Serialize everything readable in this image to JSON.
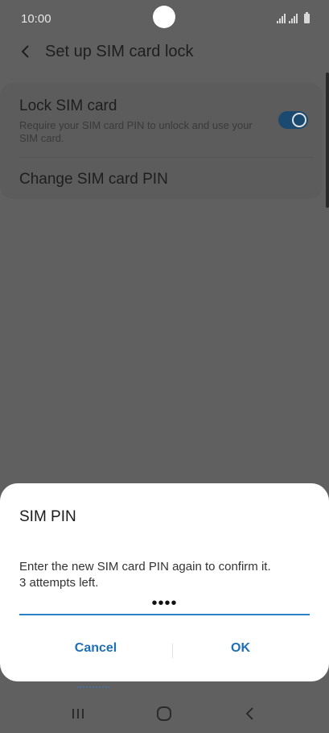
{
  "status_bar": {
    "time": "10:00",
    "icons": [
      "signal-icon",
      "signal-icon",
      "battery-icon"
    ]
  },
  "app_bar": {
    "back_icon": "chevron-left-icon",
    "title": "Set up SIM card lock"
  },
  "settings": {
    "lock_sim": {
      "title": "Lock SIM card",
      "description": "Require your SIM card PIN to unlock and use your SIM card.",
      "enabled": true
    },
    "change_pin": {
      "title": "Change SIM card PIN"
    }
  },
  "dialog": {
    "title": "SIM PIN",
    "message_line1": "Enter the new SIM card PIN again to confirm it.",
    "message_line2": "3 attempts left.",
    "pin_value": "••••",
    "cancel_label": "Cancel",
    "ok_label": "OK"
  },
  "nav_bar": {
    "items": [
      "recent-apps-icon",
      "home-icon",
      "back-icon"
    ]
  },
  "colors": {
    "accent": "#1e6fb5",
    "input_underline": "#2e7fc7",
    "toggle_track": "#1b4a70"
  }
}
